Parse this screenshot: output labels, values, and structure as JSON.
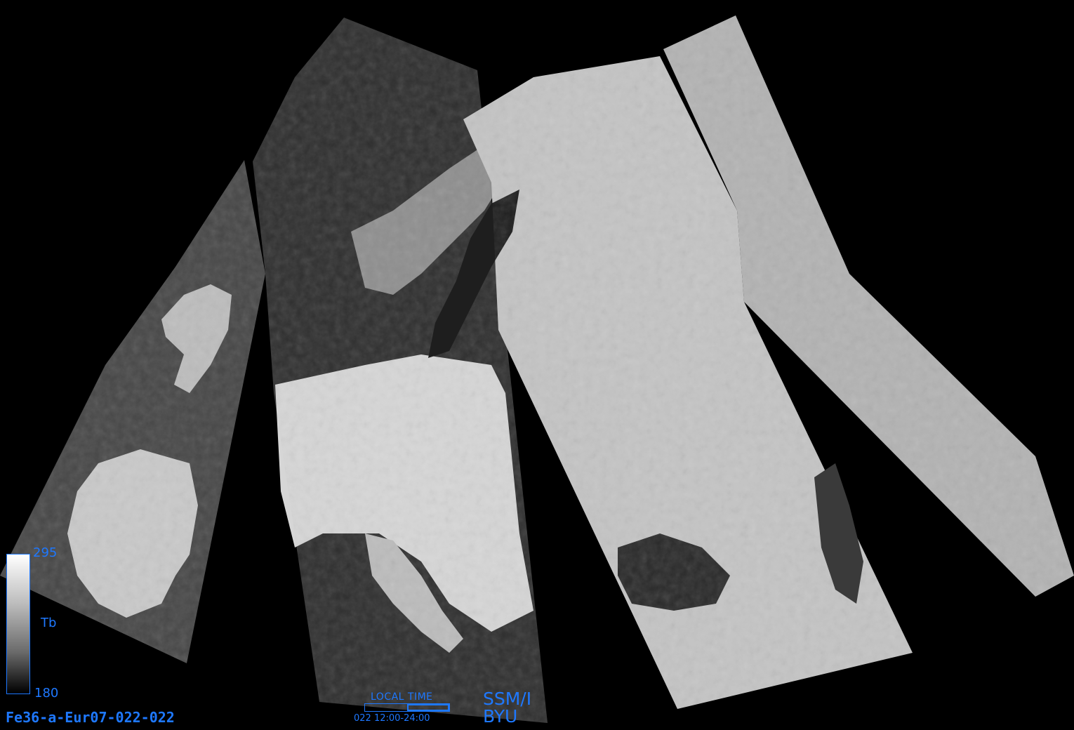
{
  "image_id": "Fe36-a-Eur07-022-022",
  "colorbar": {
    "max": "295",
    "min": "180",
    "label": "Tb"
  },
  "local_time": {
    "title": "LOCAL TIME",
    "range": "022  12:00-24:00",
    "fraction_start": 0.5,
    "fraction_end": 1.0
  },
  "sensor": "SSM/I",
  "organization": "BYU",
  "colors": {
    "annotation": "#1e78ff",
    "background": "#000000"
  }
}
